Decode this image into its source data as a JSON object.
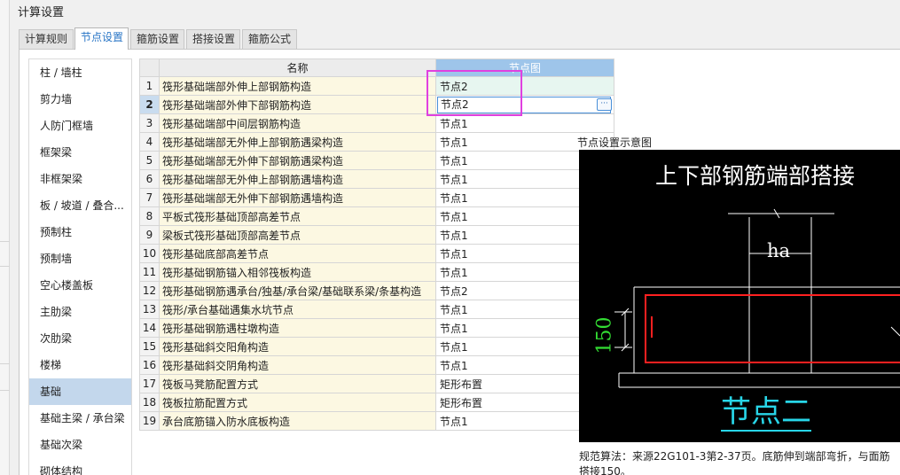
{
  "window": {
    "title": "计算设置"
  },
  "tabs": [
    "计算规则",
    "节点设置",
    "箍筋设置",
    "搭接设置",
    "箍筋公式"
  ],
  "active_tab": "节点设置",
  "sidebar": {
    "items": [
      "柱 / 墙柱",
      "剪力墙",
      "人防门框墙",
      "框架梁",
      "非框架梁",
      "板 / 坡道 / 叠合...",
      "预制柱",
      "预制墙",
      "空心楼盖板",
      "主肋梁",
      "次肋梁",
      "楼梯",
      "基础",
      "基础主梁 / 承台梁",
      "基础次梁",
      "砌体结构"
    ],
    "active": "基础"
  },
  "grid": {
    "headers": {
      "name": "名称",
      "diagram": "节点图"
    },
    "rows": [
      {
        "num": "1",
        "name": "筏形基础端部外伸上部钢筋构造",
        "node": "节点2"
      },
      {
        "num": "2",
        "name": "筏形基础端部外伸下部钢筋构造",
        "node": "节点2"
      },
      {
        "num": "3",
        "name": "筏形基础端部中间层钢筋构造",
        "node": "节点1"
      },
      {
        "num": "4",
        "name": "筏形基础端部无外伸上部钢筋遇梁构造",
        "node": "节点1"
      },
      {
        "num": "5",
        "name": "筏形基础端部无外伸下部钢筋遇梁构造",
        "node": "节点1"
      },
      {
        "num": "6",
        "name": "筏形基础端部无外伸上部钢筋遇墙构造",
        "node": "节点1"
      },
      {
        "num": "7",
        "name": "筏形基础端部无外伸下部钢筋遇墙构造",
        "node": "节点1"
      },
      {
        "num": "8",
        "name": "平板式筏形基础顶部高差节点",
        "node": "节点1"
      },
      {
        "num": "9",
        "name": "梁板式筏形基础顶部高差节点",
        "node": "节点1"
      },
      {
        "num": "10",
        "name": "筏形基础底部高差节点",
        "node": "节点1"
      },
      {
        "num": "11",
        "name": "筏形基础钢筋锚入相邻筏板构造",
        "node": "节点1"
      },
      {
        "num": "12",
        "name": "筏形基础钢筋遇承台/独基/承台梁/基础联系梁/条基构造",
        "node": "节点2"
      },
      {
        "num": "13",
        "name": "筏形/承台基础遇集水坑节点",
        "node": "节点1"
      },
      {
        "num": "14",
        "name": "筏形基础钢筋遇柱墩构造",
        "node": "节点1"
      },
      {
        "num": "15",
        "name": "筏形基础斜交阳角构造",
        "node": "节点1"
      },
      {
        "num": "16",
        "name": "筏形基础斜交阴角构造",
        "node": "节点1"
      },
      {
        "num": "17",
        "name": "筏板马凳筋配置方式",
        "node": "矩形布置"
      },
      {
        "num": "18",
        "name": "筏板拉筋配置方式",
        "node": "矩形布置"
      },
      {
        "num": "19",
        "name": "承台底筋锚入防水底板构造",
        "node": "节点1"
      }
    ],
    "selected_row": "2",
    "edit_value": "节点2",
    "ellipsis": "···"
  },
  "diagram": {
    "caption": "节点设置示意图",
    "title": "上下部钢筋端部搭接",
    "dim_ha": "ha",
    "dim_150": "150",
    "node_label": "节点二"
  },
  "rule_text": "规范算法：来源22G101-3第2-37页。底筋伸到端部弯折，与面筋搭接150。",
  "colors": {
    "accent": "#2a76c6",
    "highlight": "#e040e0",
    "diagram_bg": "#000000",
    "rebar": "#ff2020",
    "node_label": "#28d6e8",
    "dim_green": "#33dd33"
  }
}
